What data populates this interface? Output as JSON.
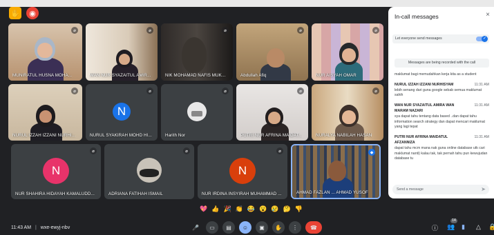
{
  "meeting": {
    "time": "11:43 AM",
    "separator": "|",
    "code": "wxe-ewyj-nbv"
  },
  "participants": [
    {
      "name": "MUNIRATUL HUSNA MOHA..."
    },
    {
      "name": "WAN NUR SYAZAITUL AMIR..."
    },
    {
      "name": "NIK MOHAMAD NAFIS MUK..."
    },
    {
      "name": "Abdullah Afiq"
    },
    {
      "name": "NUR AISYAH OMAR"
    },
    {
      "name": "NURUL IZZAH IZZANI NURHI..."
    },
    {
      "name": "NURUL SYAKIRAH MOHD HI...",
      "avatar_letter": "N",
      "avatar_color": "#1a73e8"
    },
    {
      "name": "Harith Nor"
    },
    {
      "name": "PUTRI NUR AFRINA MAIDAT..."
    },
    {
      "name": "NURALYA NABILAH HASAN"
    },
    {
      "name": "NUR SHAHIRA HIDAYAH KAMALUDD...",
      "avatar_letter": "N",
      "avatar_color": "#e8336a"
    },
    {
      "name": "ADRIANA FATIHAH ISMAIL"
    },
    {
      "name": "NUR IRDINA INSYIRAH MUHAMMAD ...",
      "avatar_letter": "N",
      "avatar_color": "#d93f0b"
    },
    {
      "name": "AHMAD FAZLAN ... AHMAD YUSOF"
    }
  ],
  "chat": {
    "title": "In-call messages",
    "close_icon": "×",
    "toggle_label": "Let everyone send messages",
    "toggle_check": "✓",
    "recording_notice": "Messages are being recorded with the call",
    "messages": [
      {
        "sender": "",
        "time": "",
        "text": "maklumat bagi memudahkan kerja kita as a student"
      },
      {
        "sender": "NURUL IZZAH IZZANI NURHISYAM",
        "time": "11:31 AM",
        "text": "lebih senang dari guna google sebab semua maklumat sahih"
      },
      {
        "sender": "WAN NUR SYAZAITUL AMIRA WAN MARAM NAZARI",
        "time": "11:31 AM",
        "text": "sya dapat tahu tentang data based ..dan dapat tahu information search strategy dan dapat mencari maklumat yang lagi tepat"
      },
      {
        "sender": "PUTRI NUR AFRINA MAIDATUL AFZANNIZA",
        "time": "11:31 AM",
        "text": "dapat tahu mcm mana nak guna online database utk cari maklumat nanti) kalau tak, tak pernah tahu pun kewujudan database tu"
      }
    ],
    "send_placeholder": "Send a message",
    "send_icon": "➤"
  },
  "reactions": [
    "💖",
    "👍",
    "🎉",
    "👏",
    "😂",
    "😮",
    "😢",
    "🤔",
    "👎"
  ],
  "controls": {
    "badge_count": "14"
  },
  "colors": {
    "bg": "#202124",
    "accent": "#1a73e8",
    "end_call": "#ea4335"
  }
}
